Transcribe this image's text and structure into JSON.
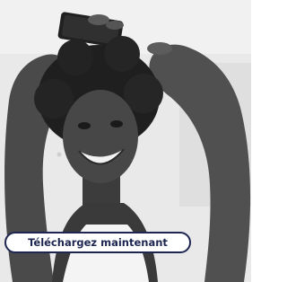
{
  "ad": {
    "image_alt": "Smiling woman holding a smartphone above her head",
    "cta_label": "Téléchargez maintenant"
  },
  "colors": {
    "cta_text": "#1d2650",
    "cta_border": "#1d2650",
    "cta_background": "#ffffff",
    "photo_tone": "grayscale"
  }
}
